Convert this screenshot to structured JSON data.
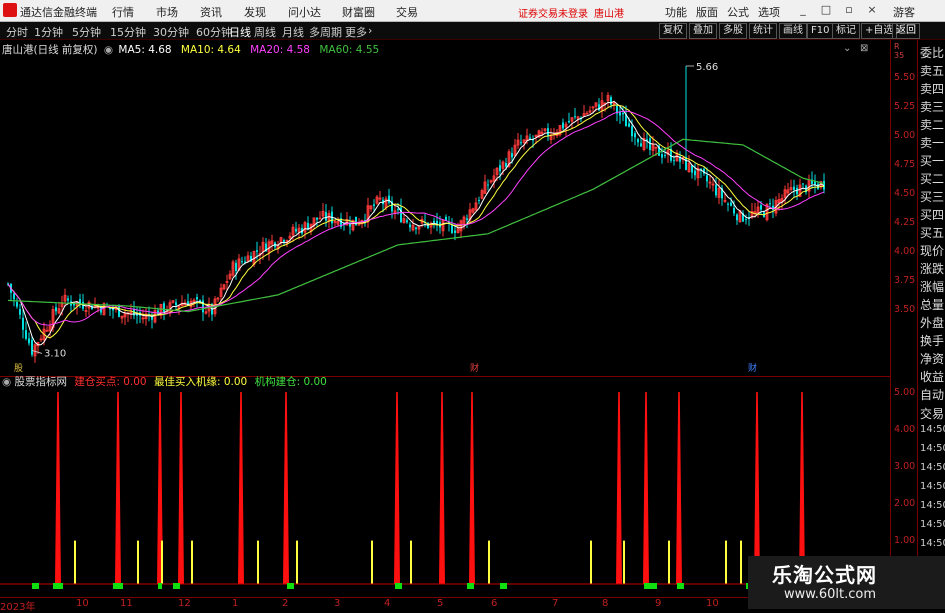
{
  "menubar": {
    "app_title": "通达信金融终端",
    "items": [
      "行情",
      "市场",
      "资讯",
      "发现",
      "问小达",
      "财富圈",
      "交易"
    ],
    "notice": "证券交易未登录",
    "stock_name": "唐山港",
    "right_items": [
      "功能",
      "版面",
      "公式",
      "选项"
    ],
    "guest": "游客"
  },
  "toolbar": {
    "periods": [
      "分时",
      "1分钟",
      "5分钟",
      "15分钟",
      "30分钟",
      "60分钟",
      "日线",
      "周线",
      "月线",
      "多周期",
      "更多"
    ],
    "active_period": "日线",
    "right_buttons": [
      "复权",
      "叠加",
      "多股",
      "统计",
      "画线",
      "F10",
      "标记",
      "+自选",
      "返回"
    ]
  },
  "main_info": {
    "title": "唐山港(日线 前复权)",
    "ma5": "MA5: 4.68",
    "ma10": "MA10: 4.64",
    "ma20": "MA20: 4.58",
    "ma60": "MA60: 4.55"
  },
  "annotations": {
    "high_label": "5.66",
    "low_label": "3.10",
    "event_1": "财",
    "event_2": "财",
    "event_3": "股"
  },
  "indicator_info": {
    "name": "股票指标网",
    "buy_point": "建仓买点: 0.00",
    "best_buy": "最佳买入机缘: 0.00",
    "inst_build": "机构建仓: 0.00"
  },
  "price_axis": {
    "ticks": [
      "5.50",
      "5.25",
      "5.00",
      "4.75",
      "4.50",
      "4.25",
      "4.00",
      "3.75",
      "3.50"
    ],
    "top": "R\n35"
  },
  "indicator_axis": {
    "ticks": [
      "5.00",
      "4.00",
      "3.00",
      "2.00",
      "1.00"
    ]
  },
  "right_panel": {
    "items": [
      "委比",
      "卖五",
      "卖四",
      "卖三",
      "卖二",
      "卖一",
      "买一",
      "买二",
      "买三",
      "买四",
      "买五",
      "现价",
      "涨跌",
      "涨幅",
      "总量",
      "外盘",
      "换手",
      "净资",
      "收益",
      "自动",
      "交易",
      "14:50",
      "14:50",
      "14:50",
      "14:50",
      "14:50",
      "14:50",
      "14:50"
    ]
  },
  "date_axis": {
    "labels": [
      "2023年",
      "10",
      "11",
      "12",
      "1",
      "2",
      "3",
      "4",
      "5",
      "6",
      "7",
      "8",
      "9",
      "10"
    ]
  },
  "watermark": {
    "title": "乐淘公式网",
    "url": "www.60lt.com"
  },
  "colors": {
    "up": "#ff3b3b",
    "down": "#00e0e0",
    "ma5": "#ffffff",
    "ma10": "#ffff40",
    "ma20": "#ff40ff",
    "ma60": "#40c040",
    "signal_red": "#ff1010",
    "signal_yellow": "#ffff40",
    "signal_green": "#10e010",
    "grid": "#7a0000"
  },
  "chart_data": {
    "type": "candlestick",
    "price_range": [
      3.05,
      5.75
    ],
    "price_anchors": [
      {
        "day": 0,
        "price": 3.7
      },
      {
        "day": 8,
        "price": 3.1
      },
      {
        "day": 18,
        "price": 3.55
      },
      {
        "day": 30,
        "price": 3.5
      },
      {
        "day": 45,
        "price": 3.4
      },
      {
        "day": 60,
        "price": 3.55
      },
      {
        "day": 68,
        "price": 3.45
      },
      {
        "day": 75,
        "price": 3.85
      },
      {
        "day": 86,
        "price": 4.05
      },
      {
        "day": 98,
        "price": 4.2
      },
      {
        "day": 104,
        "price": 4.3
      },
      {
        "day": 116,
        "price": 4.25
      },
      {
        "day": 124,
        "price": 4.45
      },
      {
        "day": 134,
        "price": 4.25
      },
      {
        "day": 150,
        "price": 4.2
      },
      {
        "day": 160,
        "price": 4.6
      },
      {
        "day": 170,
        "price": 4.95
      },
      {
        "day": 180,
        "price": 5.05
      },
      {
        "day": 190,
        "price": 5.2
      },
      {
        "day": 200,
        "price": 5.35
      },
      {
        "day": 206,
        "price": 5.15
      },
      {
        "day": 214,
        "price": 4.9
      },
      {
        "day": 222,
        "price": 4.85
      },
      {
        "day": 234,
        "price": 4.6
      },
      {
        "day": 244,
        "price": 4.3
      },
      {
        "day": 252,
        "price": 4.35
      },
      {
        "day": 262,
        "price": 4.55
      },
      {
        "day": 272,
        "price": 4.6
      }
    ],
    "spike": {
      "day": 226,
      "high": 5.66
    },
    "ma60_anchors": [
      {
        "day": 0,
        "price": 3.55
      },
      {
        "day": 40,
        "price": 3.5
      },
      {
        "day": 60,
        "price": 3.45
      },
      {
        "day": 90,
        "price": 3.6
      },
      {
        "day": 130,
        "price": 4.05
      },
      {
        "day": 160,
        "price": 4.15
      },
      {
        "day": 195,
        "price": 4.55
      },
      {
        "day": 225,
        "price": 5.0
      },
      {
        "day": 245,
        "price": 4.95
      },
      {
        "day": 265,
        "price": 4.65
      },
      {
        "day": 280,
        "price": 4.55
      }
    ],
    "signals_red": [
      {
        "day": 10,
        "value": 5.0
      },
      {
        "day": 30,
        "value": 5.0
      },
      {
        "day": 44,
        "value": 5.0
      },
      {
        "day": 51,
        "value": 5.0
      },
      {
        "day": 71,
        "value": 5.0
      },
      {
        "day": 86,
        "value": 5.0
      },
      {
        "day": 123,
        "value": 5.0
      },
      {
        "day": 138,
        "value": 5.0
      },
      {
        "day": 148,
        "value": 5.0
      },
      {
        "day": 197,
        "value": 5.0
      },
      {
        "day": 206,
        "value": 5.0
      },
      {
        "day": 217,
        "value": 5.0
      },
      {
        "day": 243,
        "value": 5.0
      },
      {
        "day": 258,
        "value": 5.0
      }
    ],
    "signals_yellow": [
      {
        "day": 13,
        "value": 1.0
      },
      {
        "day": 34,
        "value": 1.0
      },
      {
        "day": 42,
        "value": 1.0
      },
      {
        "day": 52,
        "value": 1.0
      },
      {
        "day": 74,
        "value": 1.0
      },
      {
        "day": 87,
        "value": 1.0
      },
      {
        "day": 112,
        "value": 1.0
      },
      {
        "day": 125,
        "value": 1.0
      },
      {
        "day": 151,
        "value": 1.0
      },
      {
        "day": 185,
        "value": 1.0
      },
      {
        "day": 196,
        "value": 1.0
      },
      {
        "day": 211,
        "value": 1.0
      },
      {
        "day": 230,
        "value": 1.0
      },
      {
        "day": 235,
        "value": 1.0
      }
    ],
    "signals_green_days": [
      2,
      3,
      9,
      10,
      11,
      29,
      30,
      31,
      44,
      49,
      50,
      87,
      88,
      123,
      124,
      147,
      148,
      158,
      159,
      206,
      207,
      208,
      209,
      217,
      218,
      240,
      242,
      243
    ],
    "indicator_range": [
      0,
      5.0
    ]
  }
}
